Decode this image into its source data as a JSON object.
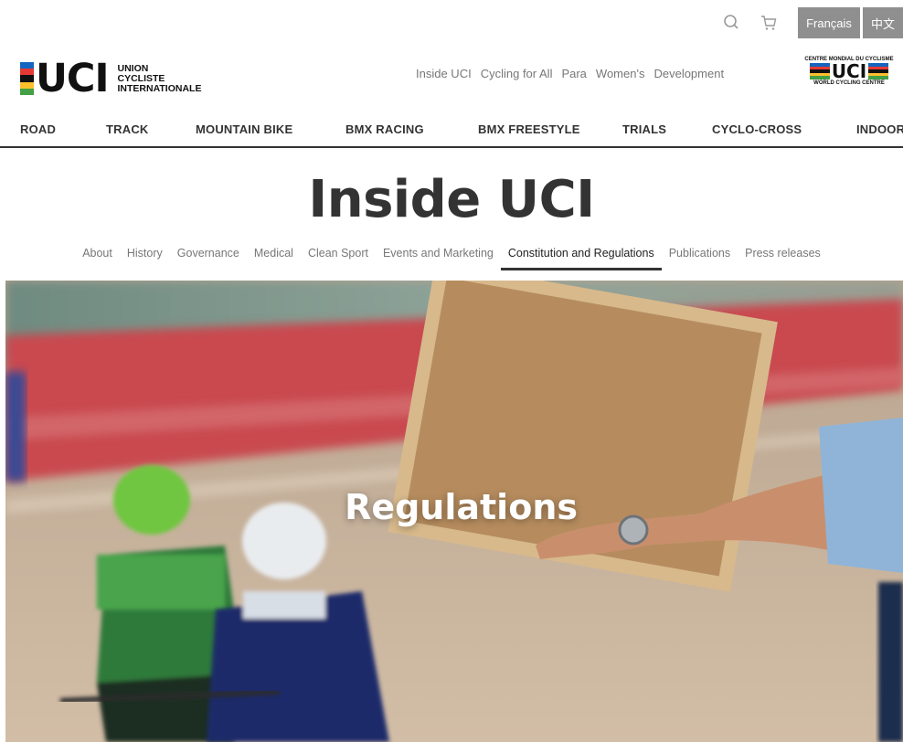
{
  "utility": {
    "search_icon": "search-icon",
    "cart_icon": "cart-icon",
    "lang_fr": "Français",
    "lang_zh": "中文"
  },
  "brand": {
    "letters": "UCI",
    "line1": "UNION",
    "line2": "CYCLISTE",
    "line3": "INTERNATIONALE",
    "colors": [
      "#1565c0",
      "#e53935",
      "#111111",
      "#fbc02d",
      "#43a047"
    ]
  },
  "topnav": [
    "Inside UCI",
    "Cycling for All",
    "Para",
    "Women's",
    "Development"
  ],
  "wcc": {
    "top": "CENTRE MONDIAL DU CYCLISME",
    "letters": "UCI",
    "bottom": "WORLD CYCLING CENTRE"
  },
  "disciplines": [
    "ROAD",
    "TRACK",
    "MOUNTAIN BIKE",
    "BMX RACING",
    "BMX FREESTYLE",
    "TRIALS",
    "CYCLO-CROSS",
    "INDOOR"
  ],
  "page_title": "Inside UCI",
  "subnav": {
    "items": [
      "About",
      "History",
      "Governance",
      "Medical",
      "Clean Sport",
      "Events and Marketing",
      "Constitution and Regulations",
      "Publications",
      "Press releases"
    ],
    "active": "Constitution and Regulations"
  },
  "hero": {
    "title": "Regulations"
  }
}
